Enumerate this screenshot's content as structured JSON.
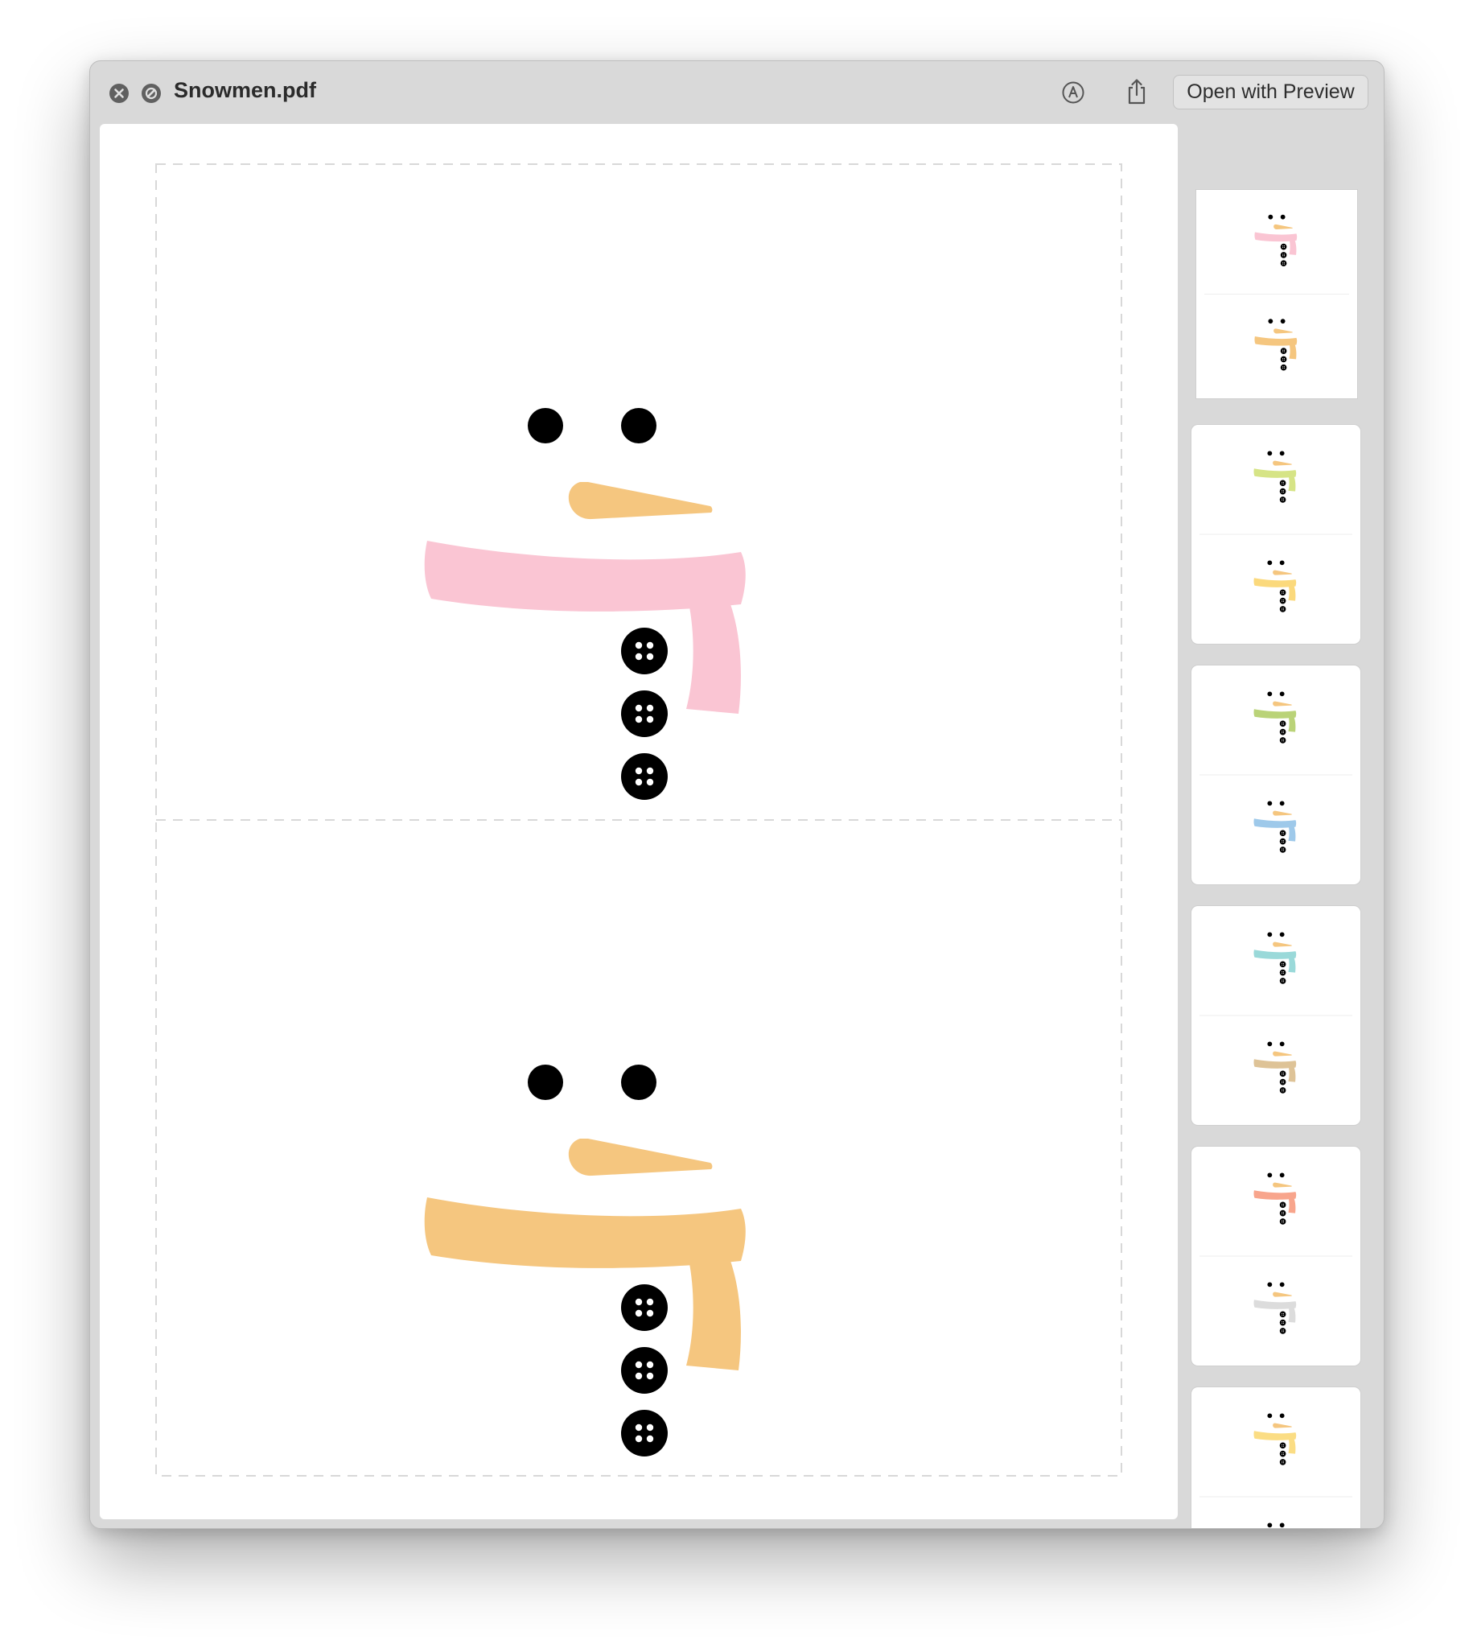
{
  "window": {
    "title": "Snowmen.pdf",
    "open_button_label": "Open with Preview"
  },
  "document": {
    "pages_shown": [
      {
        "scarf_color": "#fac5d3"
      },
      {
        "scarf_color": "#f5c67f"
      }
    ],
    "nose_color": "#f5c67f"
  },
  "thumbnails": [
    {
      "page": 1,
      "selected": true,
      "scarf_colors": [
        "#fac5d3",
        "#f5c67f"
      ]
    },
    {
      "page": 2,
      "selected": false,
      "scarf_colors": [
        "#d6e486",
        "#fbd97c"
      ]
    },
    {
      "page": 3,
      "selected": false,
      "scarf_colors": [
        "#bad378",
        "#9ec9ea"
      ]
    },
    {
      "page": 4,
      "selected": false,
      "scarf_colors": [
        "#9ad9d9",
        "#dec397"
      ]
    },
    {
      "page": 5,
      "selected": false,
      "scarf_colors": [
        "#f8a58c",
        "#dcdcdc"
      ]
    },
    {
      "page": 6,
      "selected": false,
      "scarf_colors": [
        "#fbdd84",
        "#b39be3"
      ]
    }
  ],
  "icons": {
    "close": "close-icon",
    "blocked": "blocked-icon",
    "markup": "markup-icon",
    "share": "share-icon"
  }
}
